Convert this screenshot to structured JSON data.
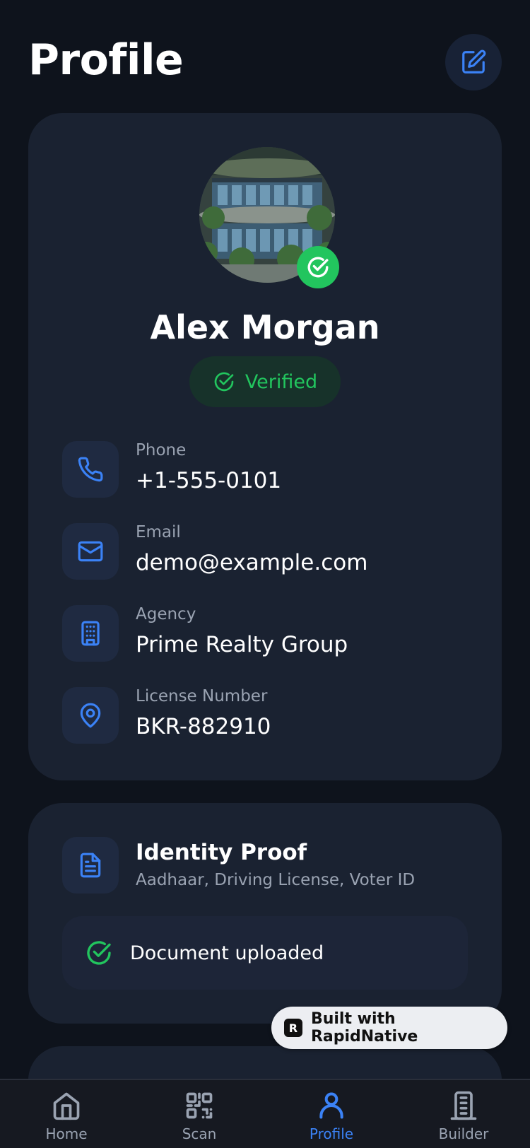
{
  "header": {
    "title": "Profile"
  },
  "profile": {
    "name": "Alex Morgan",
    "status": "Verified",
    "fields": [
      {
        "label": "Phone",
        "value": "+1-555-0101",
        "icon": "phone-icon"
      },
      {
        "label": "Email",
        "value": "demo@example.com",
        "icon": "mail-icon"
      },
      {
        "label": "Agency",
        "value": "Prime Realty Group",
        "icon": "building-icon"
      },
      {
        "label": "License Number",
        "value": "BKR-882910",
        "icon": "map-pin-icon"
      }
    ]
  },
  "identity": {
    "title": "Identity Proof",
    "subtitle": "Aadhaar, Driving License, Voter ID",
    "upload_status": "Document uploaded"
  },
  "badge": {
    "text": "Built with RapidNative"
  },
  "nav": {
    "items": [
      {
        "label": "Home",
        "icon": "home-icon"
      },
      {
        "label": "Scan",
        "icon": "qr-code-icon"
      },
      {
        "label": "Profile",
        "icon": "user-icon",
        "active": true
      },
      {
        "label": "Builder",
        "icon": "building-icon"
      }
    ]
  },
  "colors": {
    "background": "#0e131c",
    "card": "#1a2231",
    "accent": "#3b82f6",
    "success": "#22c55e",
    "muted": "#9aa3b2"
  }
}
